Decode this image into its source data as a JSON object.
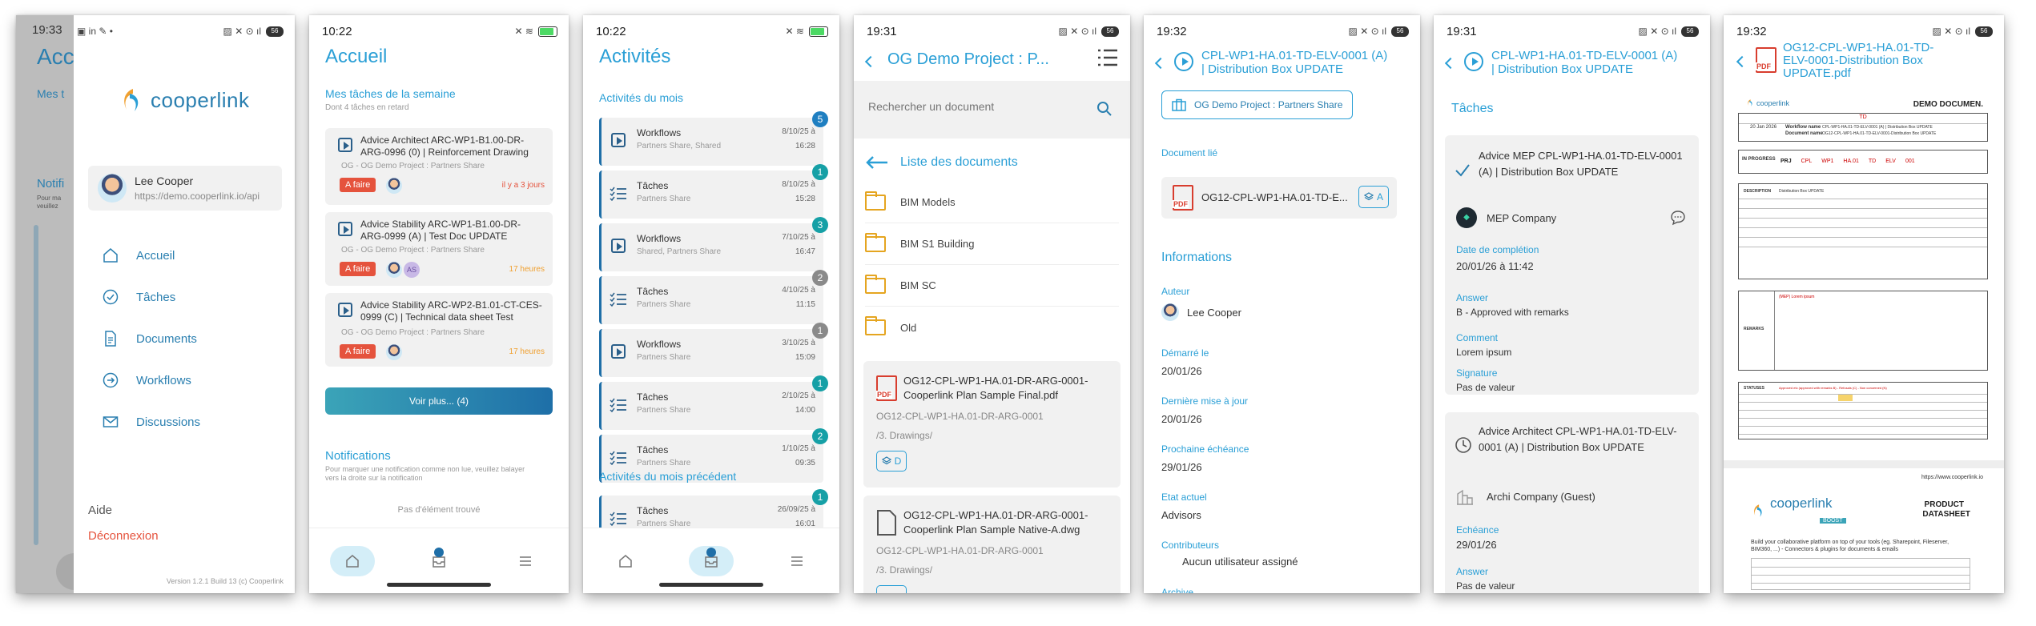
{
  "s1": {
    "time": "19:33",
    "bg_title": "Acc",
    "bg_sub": "Mes t",
    "bg_notif": "Notifi",
    "bg_notif_sub1": "Pour ma",
    "bg_notif_sub2": "veuillez",
    "logo_text": "cooperlink",
    "user_name": "Lee Cooper",
    "user_url": "https://demo.cooperlink.io/api",
    "menu": [
      {
        "label": "Accueil",
        "icon": "home-icon"
      },
      {
        "label": "Tâches",
        "icon": "check-circle-icon"
      },
      {
        "label": "Documents",
        "icon": "document-icon"
      },
      {
        "label": "Workflows",
        "icon": "arrow-circle-icon"
      },
      {
        "label": "Discussions",
        "icon": "mail-icon"
      }
    ],
    "help": "Aide",
    "logout": "Déconnexion",
    "version": "Version 1.2.1 Build 13 (c) Cooperlink"
  },
  "s2": {
    "time": "10:22",
    "title": "Accueil",
    "section": "Mes tâches de la semaine",
    "sub": "Dont 4 tâches en retard",
    "tasks": [
      {
        "title": "Advice Architect ARC-WP1-B1.00-DR-ARG-0996 (0) | Reinforcement Drawing",
        "project": "OG - OG Demo Project : Partners Share",
        "tag": "A faire",
        "due": "il y a 3 jours",
        "due_color": "red"
      },
      {
        "title": "Advice Stability ARC-WP1-B1.00-DR-ARG-0999 (A) | Test Doc UPDATE",
        "project": "OG - OG Demo Project : Partners Share",
        "tag": "A faire",
        "due": "17 heures",
        "due_color": "orange",
        "extra": "AS"
      },
      {
        "title": "Advice Stability ARC-WP2-B1.01-CT-CES-0999 (C) | Technical data sheet Test",
        "project": "OG - OG Demo Project : Partners Share",
        "tag": "A faire",
        "due": "17 heures",
        "due_color": "orange"
      }
    ],
    "more_button": "Voir plus... (4)",
    "notif_title": "Notifications",
    "notif_sub": "Pour marquer une notification comme non lue, veuillez balayer vers la droite sur la notification",
    "empty": "Pas d'élément trouvé"
  },
  "s3": {
    "time": "10:22",
    "title": "Activités",
    "month": "Activités du mois",
    "prev_month": "Activités du mois précédent",
    "items": [
      {
        "type": "Workflows",
        "sub": "Partners Share, Shared",
        "date": "8/10/25 à",
        "time": "16:28",
        "badge": "5",
        "badge_color": "blue",
        "icon": "workflow"
      },
      {
        "type": "Tâches",
        "sub": "Partners Share",
        "date": "8/10/25 à",
        "time": "15:28",
        "badge": "1",
        "badge_color": "teal",
        "icon": "tasks"
      },
      {
        "type": "Workflows",
        "sub": "Shared, Partners Share",
        "date": "7/10/25 à",
        "time": "16:47",
        "badge": "3",
        "badge_color": "teal",
        "icon": "workflow"
      },
      {
        "type": "Tâches",
        "sub": "Partners Share",
        "date": "4/10/25 à",
        "time": "11:15",
        "badge": "2",
        "badge_color": "grey",
        "icon": "tasks"
      },
      {
        "type": "Workflows",
        "sub": "Partners Share",
        "date": "3/10/25 à",
        "time": "15:09",
        "badge": "1",
        "badge_color": "grey",
        "icon": "workflow"
      },
      {
        "type": "Tâches",
        "sub": "Partners Share",
        "date": "2/10/25 à",
        "time": "14:00",
        "badge": "1",
        "badge_color": "teal",
        "icon": "tasks"
      },
      {
        "type": "Tâches",
        "sub": "Partners Share",
        "date": "1/10/25 à",
        "time": "09:35",
        "badge": "2",
        "badge_color": "teal",
        "icon": "tasks"
      }
    ],
    "prev_items": [
      {
        "type": "Tâches",
        "sub": "Partners Share",
        "date": "26/09/25 à",
        "time": "16:01",
        "badge": "1",
        "badge_color": "teal",
        "icon": "tasks"
      }
    ]
  },
  "s4": {
    "time": "19:31",
    "title": "OG Demo Project : P...",
    "search_placeholder": "Rechercher un document",
    "list_title": "Liste des documents",
    "folders": [
      "BIM Models",
      "BIM S1 Building",
      "BIM SC",
      "Old"
    ],
    "docs": [
      {
        "name": "OG12-CPL-WP1-HA.01-DR-ARG-0001-Cooperlink Plan Sample Final.pdf",
        "code": "OG12-CPL-WP1-HA.01-DR-ARG-0001",
        "path": "/3. Drawings/",
        "badge": "D"
      },
      {
        "name": "OG12-CPL-WP1-HA.01-DR-ARG-0001-Cooperlink Plan Sample Native-A.dwg",
        "code": "OG12-CPL-WP1-HA.01-DR-ARG-0001",
        "path": "/3. Drawings/"
      }
    ]
  },
  "s5": {
    "time": "19:32",
    "title_line1": "CPL-WP1-HA.01-TD-ELV-0001 (A)",
    "title_line2": "| Distribution Box UPDATE",
    "project_btn": "OG Demo Project : Partners Share",
    "doc_label": "Document lié",
    "doc_name": "OG12-CPL-WP1-HA.01-TD-E...",
    "doc_badge": "A",
    "info_title": "Informations",
    "fields": [
      {
        "label": "Auteur",
        "value": "Lee Cooper"
      },
      {
        "label": "Démarré le",
        "value": "20/01/26"
      },
      {
        "label": "Dernière mise à jour",
        "value": "20/01/26"
      },
      {
        "label": "Prochaine échéance",
        "value": "29/01/26"
      },
      {
        "label": "Etat actuel",
        "value": "Advisors"
      },
      {
        "label": "Contributeurs",
        "value": "Aucun utilisateur assigné"
      }
    ],
    "more_label": "Archive"
  },
  "s6": {
    "time": "19:31",
    "title_line1": "CPL-WP1-HA.01-TD-ELV-0001 (A)",
    "title_line2": "| Distribution Box UPDATE",
    "section": "Tâches",
    "task1": {
      "title": "Advice MEP CPL-WP1-HA.01-TD-ELV-0001 (A) | Distribution Box UPDATE",
      "company": "MEP Company",
      "date_label": "Date de complétion",
      "date": "20/01/26 à 11:42",
      "answer_label": "Answer",
      "answer": "B - Approved with remarks",
      "comment_label": "Comment",
      "comment": "Lorem ipsum",
      "sig_label": "Signature",
      "sig": "Pas de valeur"
    },
    "task2": {
      "title": "Advice Architect CPL-WP1-HA.01-TD-ELV-0001 (A) | Distribution Box UPDATE",
      "company": "Archi Company (Guest)",
      "due_label": "Echéance",
      "due": "29/01/26",
      "answer_label": "Answer",
      "answer": "Pas de valeur"
    }
  },
  "s7": {
    "time": "19:32",
    "title": "OG12-CPL-WP1-HA.01-TD-ELV-0001-Distribution Box UPDATE.pdf",
    "title_l1": "OG12-CPL-WP1-HA.01-TD-",
    "title_l2": "ELV-0001-Distribution Box",
    "title_l3": "UPDATE.pdf",
    "pdf": {
      "brand": "cooperlink",
      "header_right": "DEMO DOCUMEN.",
      "td": "TD",
      "date": "20 Jan 2026",
      "wf_label": "Workflow name",
      "doc_label": "Document name",
      "wf_value": "CPL-WP1-HA.01-TD-ELV-0001 (A) | Distribution Box UPDATE",
      "doc_value": "OG12-CPL-WP1-HA.01-TD-ELV-0001-Distribution Box UPDATE",
      "status": "IN PROGRESS",
      "codes": [
        "PRJ",
        "CPL",
        "WP1",
        "HA.01",
        "TD",
        "ELV",
        "001"
      ],
      "description": "DESCRIPTION",
      "desc_value": "Distribution Box UPDATE",
      "remarks": "REMARKS",
      "remarks_value": "(MEP) Lorem ipsum",
      "statuses": "STATUSES",
      "statuses_value": "Approved etc (approved with remarks B) - Refusals (C) - Non concerned (N)",
      "footer_url": "https://www.cooperlink.io",
      "boost": "BOOST",
      "product": "PRODUCT",
      "datasheet": "DATASHEET",
      "tagline": "Build your collaborative platform on top of your tools (eg. Sharepoint, Fileserver, BIM360, ...) - Connectors & plugins for documents & emails"
    }
  }
}
